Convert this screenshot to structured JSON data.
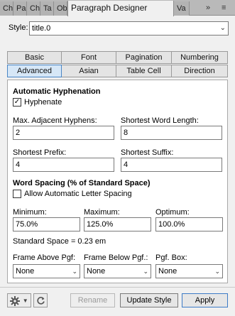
{
  "panel_tabs": [
    "Ch",
    "Pa",
    "Ch",
    "Ta",
    "Ob",
    "Paragraph Designer",
    "Va"
  ],
  "panel_controls": {
    "more": "»",
    "menu": "≡"
  },
  "style": {
    "label": "Style:",
    "value": "title.0"
  },
  "tabs_row1": [
    "Basic",
    "Font",
    "Pagination",
    "Numbering"
  ],
  "tabs_row2": [
    "Advanced",
    "Asian",
    "Table Cell",
    "Direction"
  ],
  "hyphenation": {
    "heading": "Automatic Hyphenation",
    "hyphenate_label": "Hyphenate",
    "hyphenate_checked": true,
    "max_adjacent_label": "Max. Adjacent Hyphens:",
    "max_adjacent_value": "2",
    "shortest_word_label": "Shortest Word Length:",
    "shortest_word_value": "8",
    "shortest_prefix_label": "Shortest Prefix:",
    "shortest_prefix_value": "4",
    "shortest_suffix_label": "Shortest Suffix:",
    "shortest_suffix_value": "4"
  },
  "word_spacing": {
    "heading": "Word Spacing (% of Standard Space)",
    "allow_letter_spacing_label": "Allow Automatic Letter Spacing",
    "allow_letter_spacing_checked": false,
    "minimum_label": "Minimum:",
    "minimum_value": "75.0%",
    "maximum_label": "Maximum:",
    "maximum_value": "125.0%",
    "optimum_label": "Optimum:",
    "optimum_value": "100.0%",
    "standard_space": "Standard Space = 0.23 em"
  },
  "frames": {
    "above_label": "Frame Above Pgf:",
    "above_value": "None",
    "below_label": "Frame Below Pgf.:",
    "below_value": "None",
    "box_label": "Pgf. Box:",
    "box_value": "None"
  },
  "buttons": {
    "rename": "Rename",
    "update_style": "Update Style",
    "apply": "Apply"
  },
  "icons": {
    "gear": "gear-icon",
    "refresh": "refresh-icon"
  }
}
